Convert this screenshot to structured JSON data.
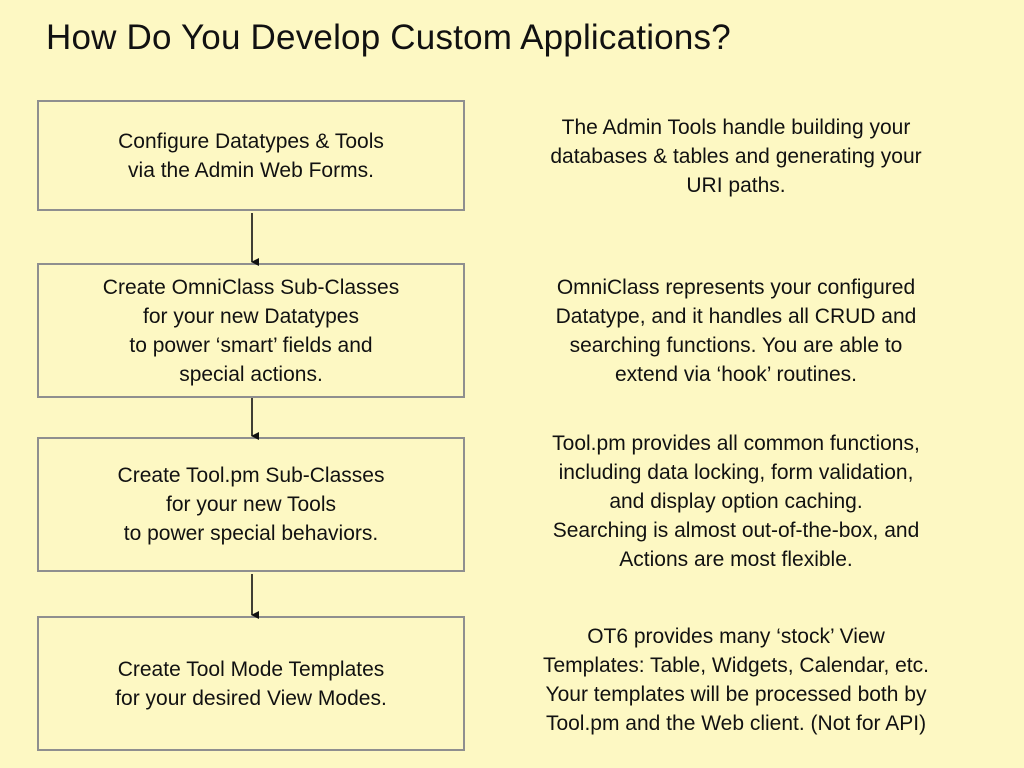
{
  "slide": {
    "title": "How Do You Develop Custom Applications?"
  },
  "steps": [
    {
      "text": "Configure Datatypes & Tools\nvia the Admin Web Forms.",
      "note": "The Admin Tools handle building your\ndatabases & tables and generating your\nURI paths."
    },
    {
      "text": "Create OmniClass Sub-Classes\nfor your new Datatypes\nto power ‘smart’ fields and\nspecial actions.",
      "note": "OmniClass represents your configured\nDatatype, and it handles all CRUD and\nsearching functions.  You are able to\nextend via ‘hook’ routines."
    },
    {
      "text": "Create Tool.pm Sub-Classes\nfor your new Tools\nto power special behaviors.",
      "note": "Tool.pm provides all common functions,\nincluding data locking, form validation,\nand display option caching.\nSearching is almost out-of-the-box, and\nActions are most flexible."
    },
    {
      "text": "Create Tool Mode Templates\nfor your desired View Modes.",
      "note": "OT6 provides many ‘stock’ View\nTemplates: Table, Widgets, Calendar, etc.\nYour templates will be processed both by\nTool.pm and the Web client.  (Not for API)"
    }
  ],
  "colors": {
    "background": "#fdf8c3",
    "box_border": "#8f8f8f",
    "text": "#111111"
  }
}
